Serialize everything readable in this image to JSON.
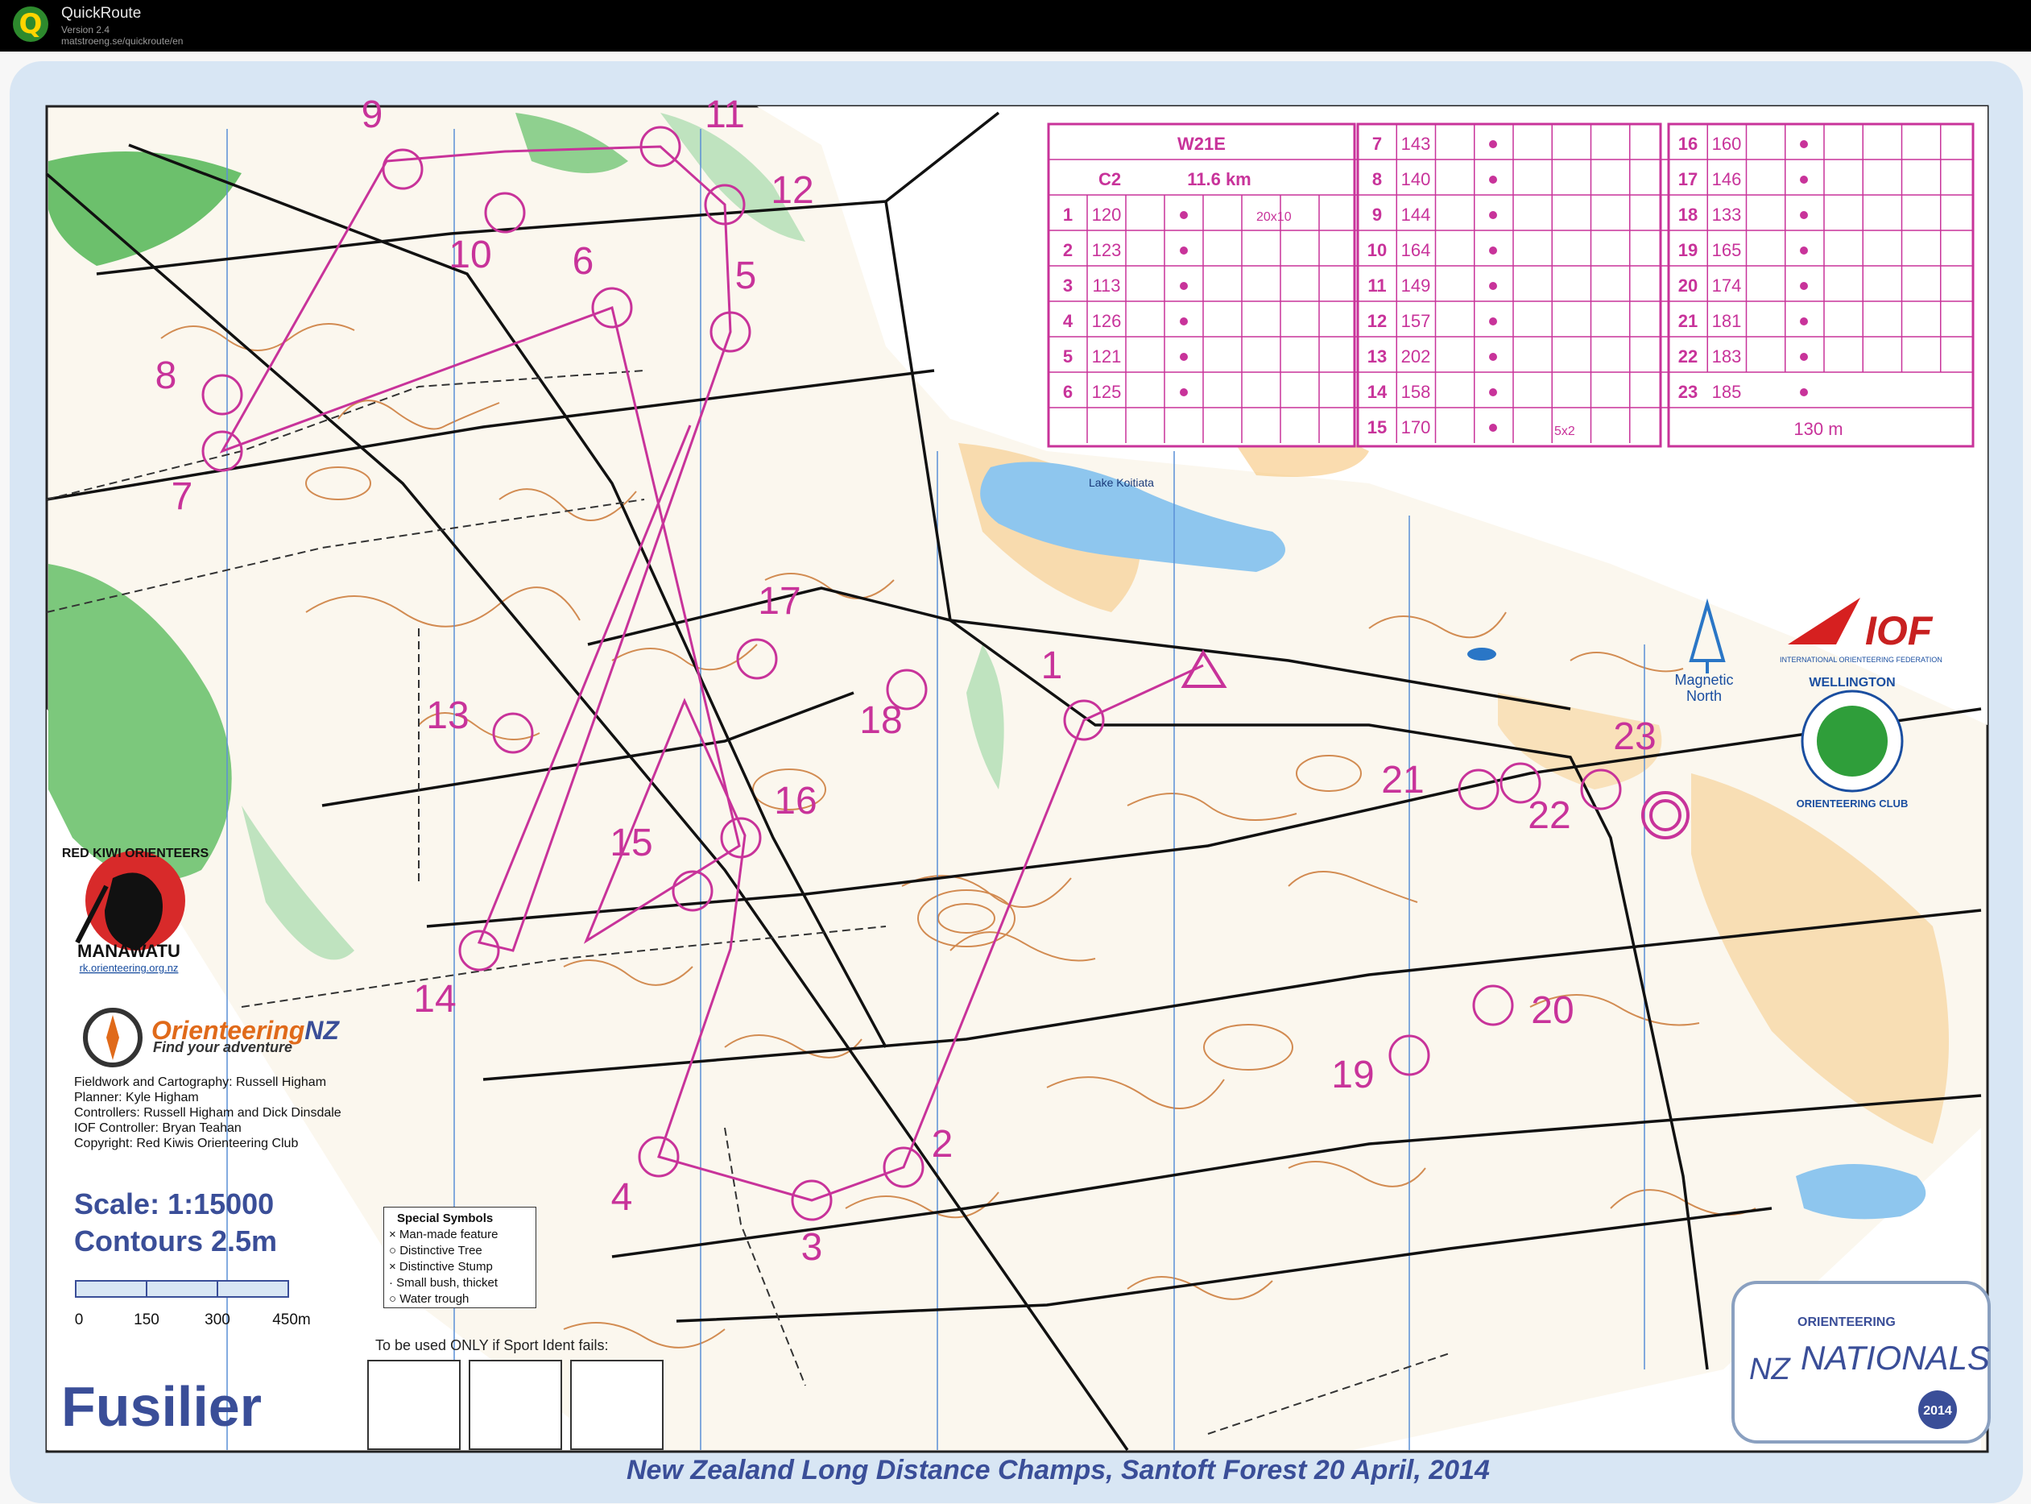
{
  "app": {
    "title": "QuickRoute",
    "version": "Version 2.4",
    "url": "matstroeng.se/quickroute/en",
    "icon": "quickroute-q-icon"
  },
  "course": {
    "class": "W21E",
    "code": "C2",
    "length": "11.6 km",
    "start_size": "20x10",
    "finish_distance": "130 m",
    "controls": [
      {
        "n": "1",
        "code": "120"
      },
      {
        "n": "2",
        "code": "123"
      },
      {
        "n": "3",
        "code": "113"
      },
      {
        "n": "4",
        "code": "126"
      },
      {
        "n": "5",
        "code": "121"
      },
      {
        "n": "6",
        "code": "125"
      },
      {
        "n": "7",
        "code": "143"
      },
      {
        "n": "8",
        "code": "140"
      },
      {
        "n": "9",
        "code": "144"
      },
      {
        "n": "10",
        "code": "164"
      },
      {
        "n": "11",
        "code": "149"
      },
      {
        "n": "12",
        "code": "157"
      },
      {
        "n": "13",
        "code": "202"
      },
      {
        "n": "14",
        "code": "158"
      },
      {
        "n": "15",
        "code": "170"
      },
      {
        "n": "16",
        "code": "160"
      },
      {
        "n": "17",
        "code": "146"
      },
      {
        "n": "18",
        "code": "133"
      },
      {
        "n": "19",
        "code": "165"
      },
      {
        "n": "20",
        "code": "174"
      },
      {
        "n": "21",
        "code": "181"
      },
      {
        "n": "22",
        "code": "183"
      },
      {
        "n": "23",
        "code": "185"
      }
    ],
    "extra_sizes": {
      "15": "5x2"
    }
  },
  "map": {
    "lake_name": "Lake Koitiata",
    "magnetic_north": "Magnetic North",
    "scale": "Scale: 1:15000",
    "contours": "Contours  2.5m",
    "scale_labels": [
      "0",
      "150",
      "300",
      "450m"
    ],
    "name": "Fusilier",
    "footer": "New Zealand Long Distance Champs, Santoft Forest    20 April, 2014",
    "sportident": "To be used ONLY if Sport Ident fails:",
    "credits": [
      "Fieldwork and Cartography: Russell Higham",
      "Planner: Kyle Higham",
      "Controllers: Russell Higham and Dick Dinsdale",
      "IOF Controller: Bryan Teahan",
      "Copyright: Red Kiwis Orienteering Club"
    ],
    "special_symbols": {
      "title": "Special Symbols",
      "items": [
        "× Man-made feature",
        "○ Distinctive Tree",
        "× Distinctive Stump",
        "· Small bush, thicket",
        "○ Water trough"
      ]
    }
  },
  "clubs": {
    "red_kiwi_top": "RED KIWI ORIENTEERS",
    "red_kiwi_bottom": "MANAWATU",
    "red_kiwi_url": "rk.orienteering.org.nz",
    "onz_name_a": "Orienteering",
    "onz_name_b": "NZ",
    "onz_tagline": "Find your adventure",
    "iof": "IOF",
    "iof_full": "INTERNATIONAL ORIENTEERING FEDERATION",
    "wellington": "WELLINGTON",
    "wellington_b": "ORIENTEERING CLUB",
    "nationals_a": "ORIENTEERING",
    "nationals_b": "NZ",
    "nationals_c": "NATIONALS",
    "nationals_year": "2014"
  },
  "colors": {
    "course": "#c8339a",
    "contour": "#c8702a",
    "water": "#2a76c6",
    "vegetation": "#5cb85c",
    "club_blue": "#3a4e98"
  }
}
